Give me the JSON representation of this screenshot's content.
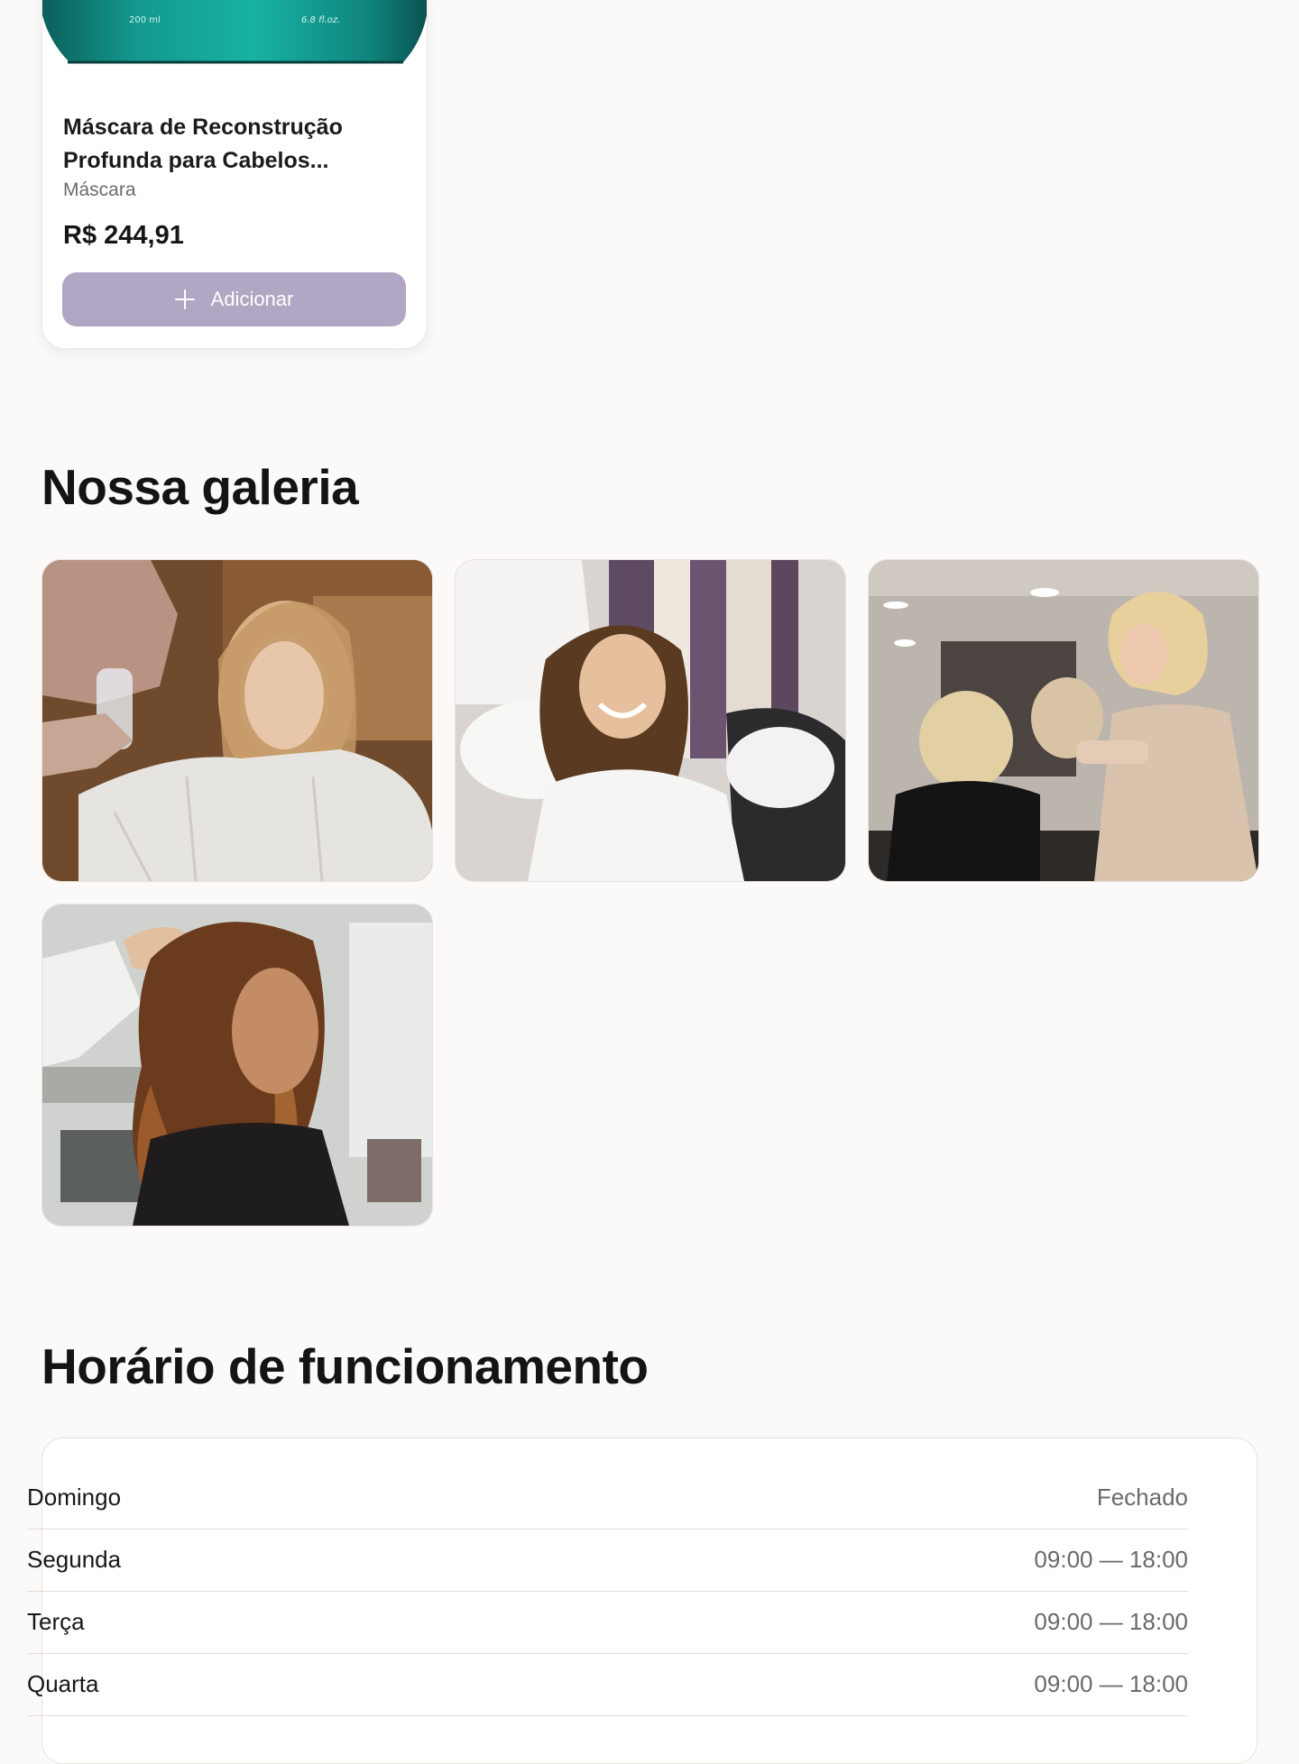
{
  "product": {
    "jar_label_left": "200 ml",
    "jar_label_right": "6.8 fl.oz.",
    "name": "Máscara de Reconstrução Profunda para Cabelos...",
    "category": "Máscara",
    "price": "R$ 244,91",
    "add_label": "Adicionar",
    "icon": "plus-icon"
  },
  "gallery": {
    "title": "Nossa galeria",
    "images": [
      {
        "name": "gallery-photo-haircut-spray"
      },
      {
        "name": "gallery-photo-hair-wash"
      },
      {
        "name": "gallery-photo-styling-spray"
      },
      {
        "name": "gallery-photo-curled-hair"
      }
    ]
  },
  "hours": {
    "title": "Horário de funcionamento",
    "rows": [
      {
        "day": "Domingo",
        "time": "Fechado"
      },
      {
        "day": "Segunda",
        "time": "09:00 — 18:00"
      },
      {
        "day": "Terça",
        "time": "09:00 — 18:00"
      },
      {
        "day": "Quarta",
        "time": "09:00 — 18:00"
      }
    ]
  },
  "colors": {
    "background": "#fbfaf8",
    "button": "#b1a6c3",
    "jar_teal": "#149a8e"
  }
}
